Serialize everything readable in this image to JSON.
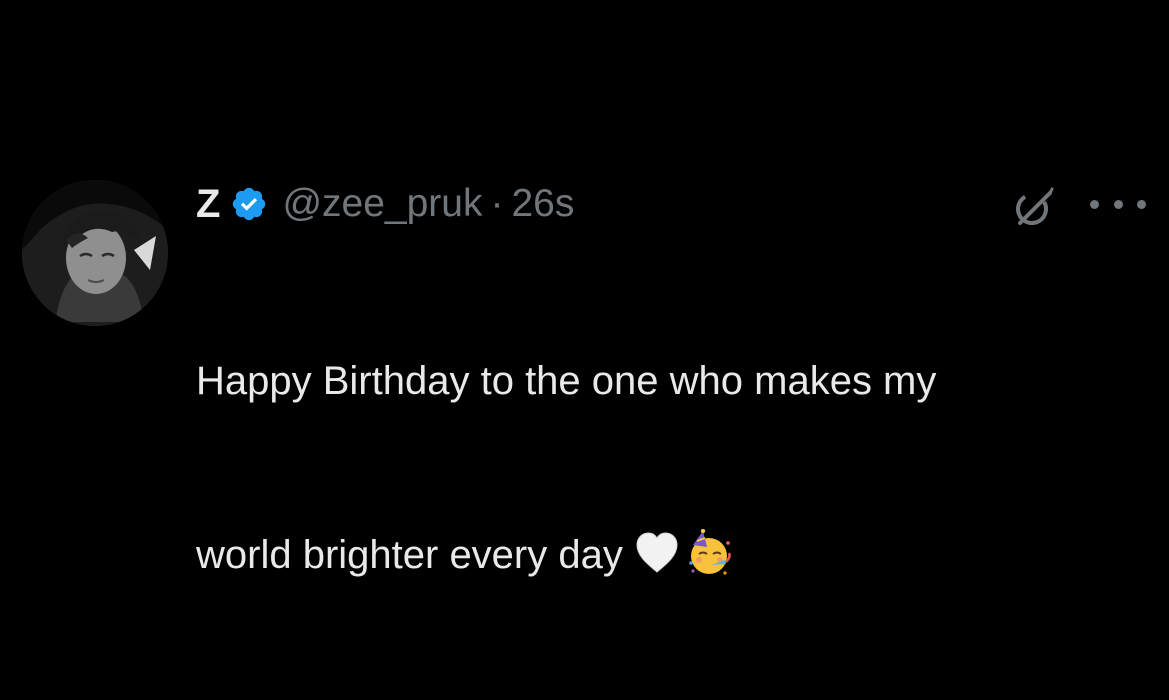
{
  "tweet": {
    "author_name": "Z",
    "handle": "@zee_pruk",
    "separator": "·",
    "time": "26s",
    "text_line_1": "Happy Birthday to the one who makes my",
    "text_line_2": "world brighter every day",
    "emojis": [
      "white-heart-emoji",
      "partying-face-emoji"
    ]
  },
  "colors": {
    "background": "#000000",
    "primary_text": "#e7e9ea",
    "secondary_text": "#71767b",
    "verified_badge": "#1d9bf0"
  },
  "icons": {
    "verified": "verified-badge-icon",
    "grok": "grok-icon",
    "more": "more-options-icon"
  }
}
